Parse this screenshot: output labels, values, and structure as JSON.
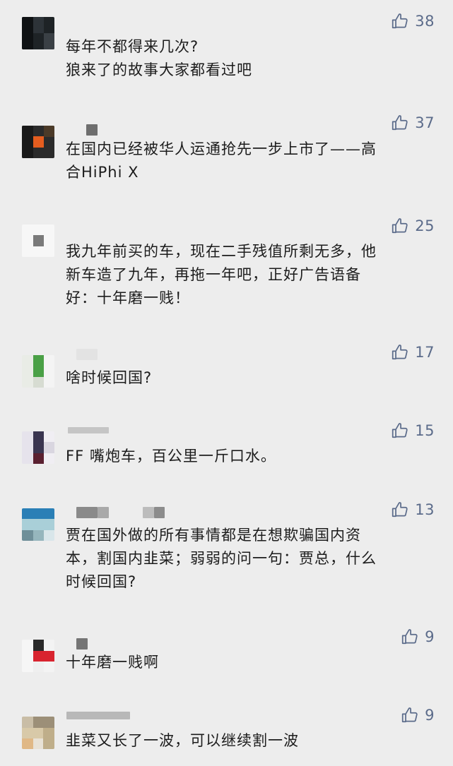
{
  "comments": [
    {
      "likes": "38",
      "text": "每年不都得来几次?\n狼来了的故事大家都看过吧"
    },
    {
      "likes": "37",
      "text": "在国内已经被华人运通抢先一步上市了——高\n合HiPhi X"
    },
    {
      "likes": "25",
      "text": "我九年前买的车，现在二手残值所剩无多，他\n新车造了九年，再拖一年吧，正好广告语备\n好：十年磨一贱！"
    },
    {
      "likes": "17",
      "text": "啥时候回国?"
    },
    {
      "likes": "15",
      "text": "FF 嘴炮车，百公里一斤口水。"
    },
    {
      "likes": "13",
      "text": "贾在国外做的所有事情都是在想欺骗国内资\n本，割国内韭菜；弱弱的问一句：贾总，什么\n时候回国?"
    },
    {
      "likes": "9",
      "text": "十年磨一贱啊"
    },
    {
      "likes": "9",
      "text": "韭菜又长了一波，可以继续割一波"
    }
  ],
  "colors": {
    "background": "#ededed",
    "text": "#1c1c1c",
    "like_count": "#5b6b8a",
    "like_icon": "#5b6b8a"
  },
  "icons": {
    "like": "thumbs-up-icon"
  }
}
